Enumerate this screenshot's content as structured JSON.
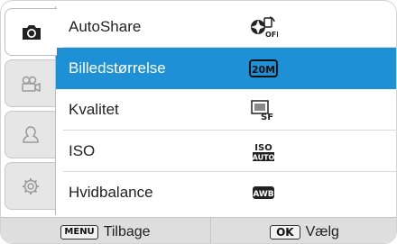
{
  "sidebar": {
    "tabs": [
      {
        "icon": "camera-icon",
        "active": true
      },
      {
        "icon": "video-camera-icon",
        "active": false
      },
      {
        "icon": "person-icon",
        "active": false
      },
      {
        "icon": "gear-icon",
        "active": false
      }
    ]
  },
  "menu": {
    "items": [
      {
        "label": "AutoShare",
        "value_icon": "autoshare-off-icon",
        "value_text": "OFF"
      },
      {
        "label": "Billedstørrelse",
        "value_icon": "photo-size-20m-icon",
        "value_text": "20M",
        "selected": true
      },
      {
        "label": "Kvalitet",
        "value_icon": "quality-superfine-icon",
        "value_text": "SF"
      },
      {
        "label": "ISO",
        "value_icon": "iso-auto-icon",
        "value_text": "ISO AUTO"
      },
      {
        "label": "Hvidbalance",
        "value_icon": "white-balance-auto-icon",
        "value_text": "AWB"
      }
    ]
  },
  "footer": {
    "back_key": "MENU",
    "back_label": "Tilbage",
    "select_key": "OK",
    "select_label": "Vælg"
  },
  "colors": {
    "selected": "#1e90d6",
    "bar": "#dedede"
  }
}
